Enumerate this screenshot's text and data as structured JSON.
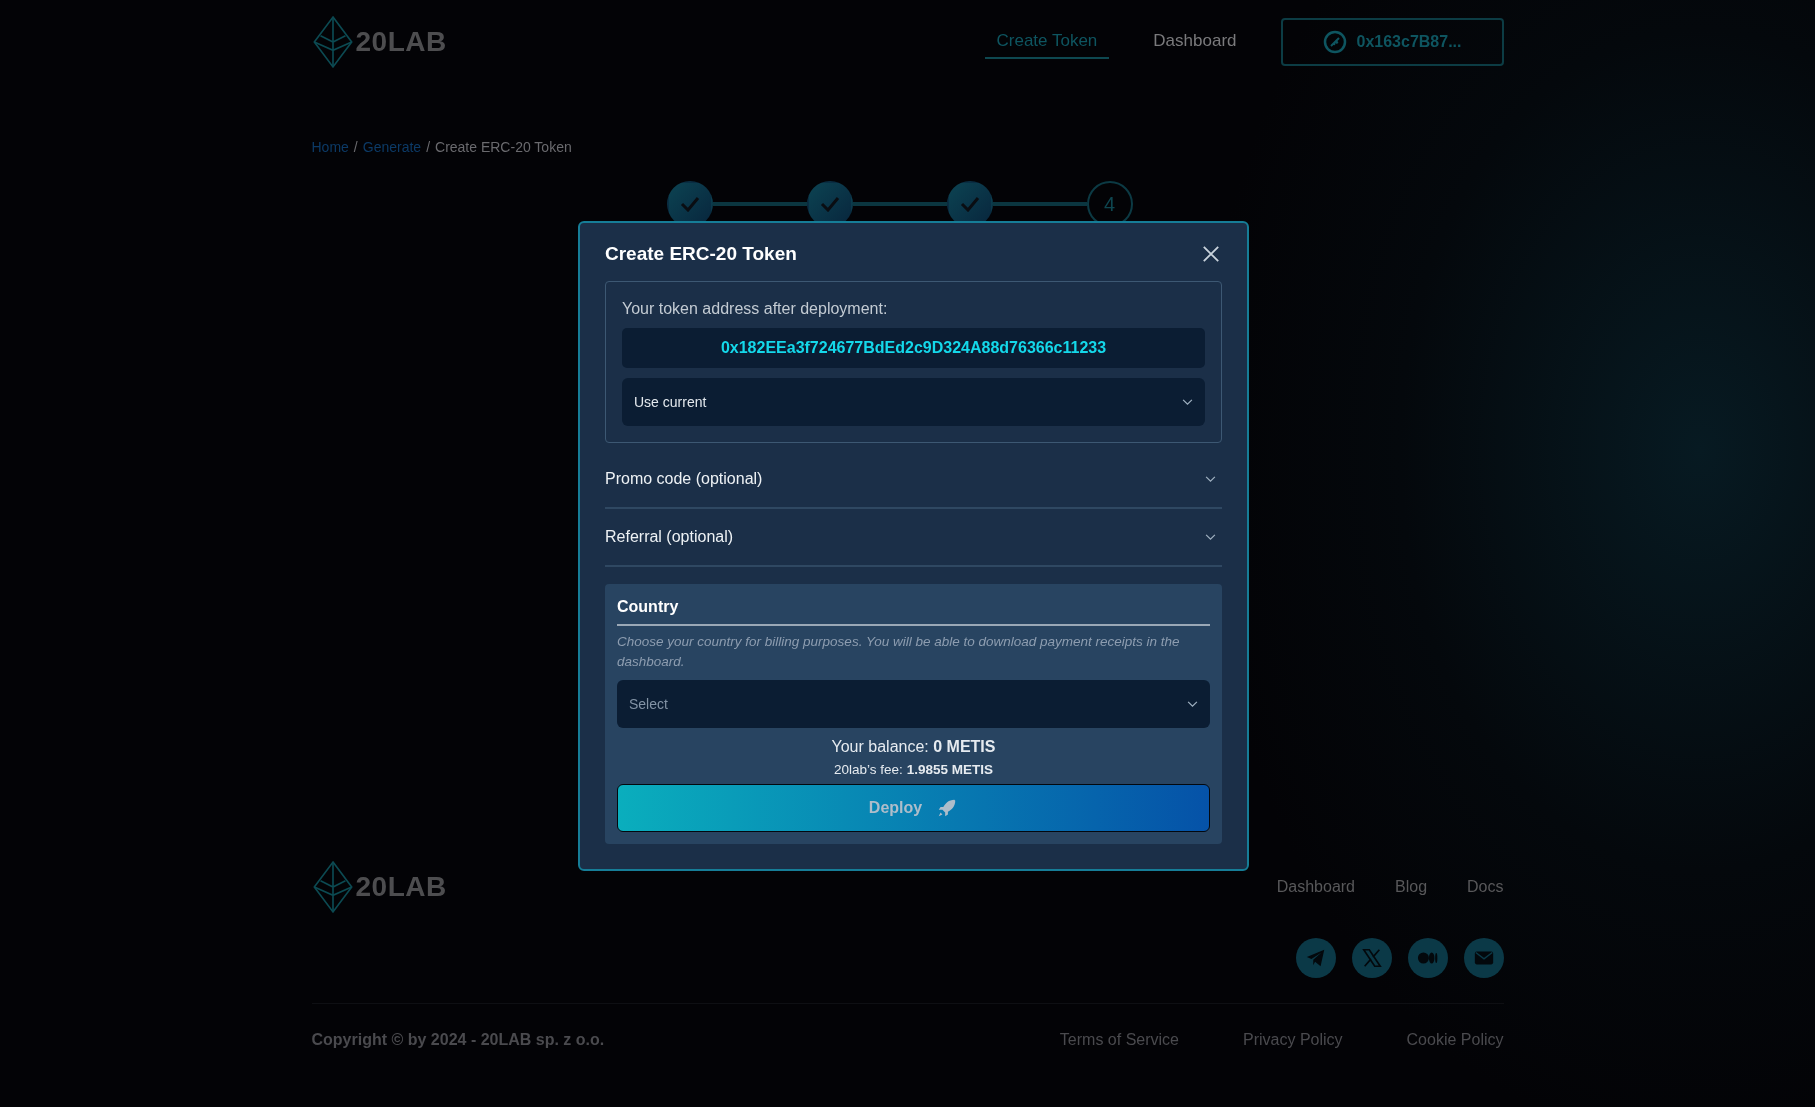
{
  "header": {
    "logo": "20LAB",
    "nav": [
      {
        "label": "Create Token",
        "selected": true
      },
      {
        "label": "Dashboard",
        "selected": false
      }
    ],
    "wallet": "0x163c7B87..."
  },
  "breadcrumb": [
    {
      "label": "Home",
      "kind": "link"
    },
    {
      "label": "/",
      "kind": "separator"
    },
    {
      "label": "Generate",
      "kind": "link"
    },
    {
      "label": "/",
      "kind": "separator"
    },
    {
      "label": "Create ERC-20 Token",
      "kind": "current"
    }
  ],
  "steps": [
    {
      "done": true
    },
    {
      "done": true
    },
    {
      "done": true
    },
    {
      "done": false,
      "label": "4"
    }
  ],
  "modal": {
    "title": "Create ERC-20 Token",
    "address_label": "Your token address after deployment:",
    "address": "0x182EEa3f724677BdEd2c9D324A88d76366c11233",
    "address_mode": "Use current",
    "sections": [
      {
        "label": "Promo code (optional)",
        "expanded": false
      },
      {
        "label": "Referral (optional)",
        "expanded": false
      }
    ],
    "country": {
      "title": "Country",
      "hint": "Choose your country for billing purposes. You will be able to download payment receipts in the dashboard.",
      "placeholder": "Select"
    },
    "balance": "Your balance: **0 METIS**",
    "fee": "20lab’s fee: **1.9855 METIS**",
    "deploy": {
      "label": "Deploy",
      "disabled": true
    }
  },
  "footer": {
    "logo": "20LAB",
    "links": [
      "Dashboard",
      "Blog",
      "Docs"
    ],
    "socials": [
      {
        "kind": "telegram"
      },
      {
        "kind": "x"
      },
      {
        "kind": "medium"
      },
      {
        "kind": "mail"
      }
    ],
    "copyright": "Copyright © by 2024 - 20LAB sp. z o.o.",
    "legal": [
      "Terms of Service",
      "Privacy Policy",
      "Cookie Policy"
    ]
  }
}
